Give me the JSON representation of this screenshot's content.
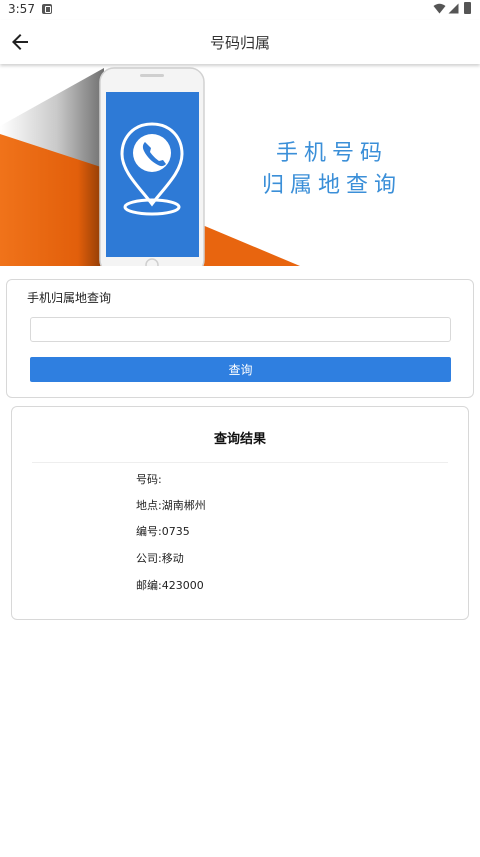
{
  "status_bar": {
    "time": "3:57",
    "icons": [
      "notification-icon",
      "wifi-icon",
      "signal-icon",
      "battery-icon"
    ]
  },
  "app_bar": {
    "back_icon": "arrow-left-icon",
    "title": "号码归属"
  },
  "banner": {
    "line1": "手机号码",
    "line2": "归属地查询",
    "colors": {
      "orange": "#e8650f",
      "blue": "#2e7ad6",
      "text_blue": "#3b8fd8"
    }
  },
  "query": {
    "label": "手机归属地查询",
    "input_value": "",
    "button_label": "查询",
    "button_color": "#2f7fe0"
  },
  "result": {
    "title": "查询结果",
    "rows": [
      {
        "text": "号码:"
      },
      {
        "text": "地点:湖南郴州"
      },
      {
        "text": "编号:0735"
      },
      {
        "text": "公司:移动"
      },
      {
        "text": "邮编:423000"
      }
    ]
  }
}
